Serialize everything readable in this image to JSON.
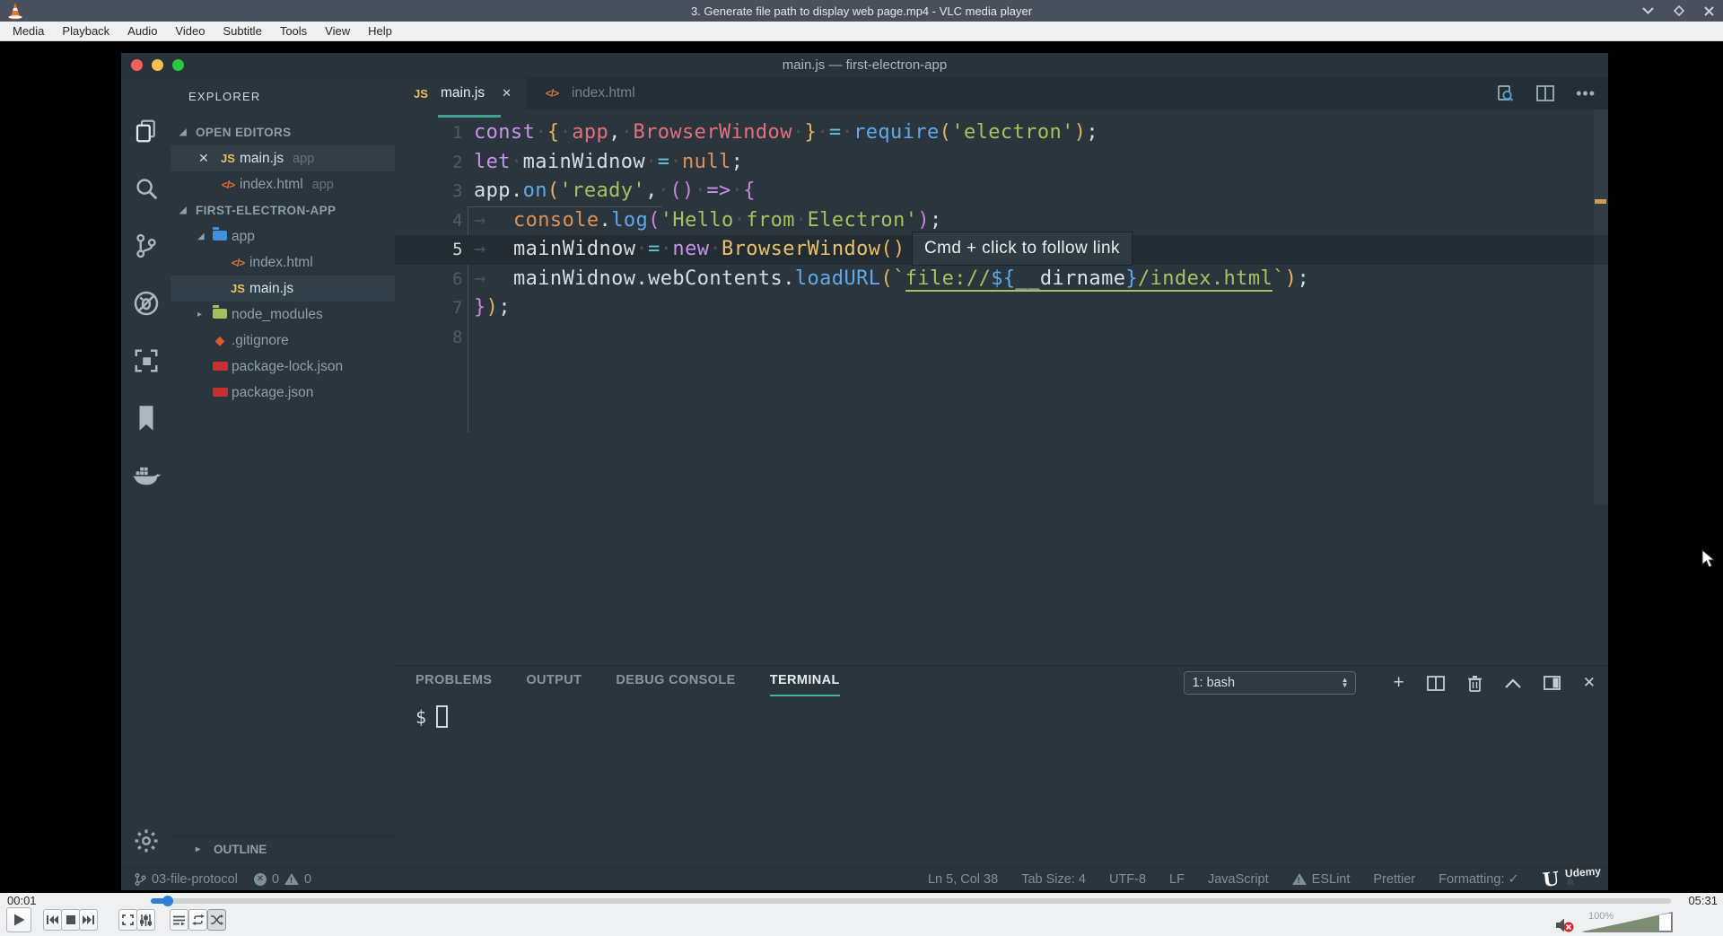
{
  "vlc": {
    "title": "3. Generate file path to display web page.mp4 - VLC media player",
    "menu": [
      "Media",
      "Playback",
      "Audio",
      "Video",
      "Subtitle",
      "Tools",
      "View",
      "Help"
    ],
    "window_controls": {
      "minimize": "chevron-down",
      "maximize": "diamond",
      "close": "✕"
    },
    "time_current": "00:01",
    "time_total": "05:31",
    "volume_label": "100%",
    "position_pct": 1,
    "transport": [
      "play",
      "previous",
      "stop",
      "next",
      "fullscreen",
      "extended-settings",
      "playlist",
      "loop",
      "random"
    ],
    "random_active": true
  },
  "vscode": {
    "window_title": "main.js — first-electron-app",
    "activity_icons": [
      "files",
      "search",
      "source-control",
      "debug",
      "extensions",
      "bookmark",
      "docker",
      "settings-gear"
    ],
    "explorer": {
      "header": "EXPLORER",
      "open_editors_label": "OPEN EDITORS",
      "open_editors": [
        {
          "close": "✕",
          "icon": "js",
          "name": "main.js",
          "badge": "app",
          "hl": true
        },
        {
          "icon": "html",
          "name": "index.html",
          "badge": "app"
        }
      ],
      "project_label": "FIRST-ELECTRON-APP",
      "tree": [
        {
          "arrow": "expanded",
          "icon": "folder-blue",
          "name": "app",
          "depth": 1
        },
        {
          "icon": "html",
          "name": "index.html",
          "depth": 2
        },
        {
          "icon": "js",
          "name": "main.js",
          "depth": 2,
          "hl": true
        },
        {
          "arrow": "collapsed",
          "icon": "folder-green",
          "name": "node_modules",
          "depth": 1
        },
        {
          "icon": "git",
          "name": ".gitignore",
          "depth": 1
        },
        {
          "icon": "npm",
          "name": "package-lock.json",
          "depth": 1
        },
        {
          "icon": "npm",
          "name": "package.json",
          "depth": 1
        }
      ],
      "outline_label": "OUTLINE"
    },
    "tabs": [
      {
        "icon": "js",
        "label": "main.js",
        "close": "✕",
        "active": true
      },
      {
        "icon": "html",
        "label": "index.html"
      }
    ],
    "editor": {
      "tooltip": "Cmd + click to follow link",
      "lines": [
        {
          "n": "1",
          "t": [
            [
              "kw",
              "const"
            ],
            [
              "fg",
              " "
            ],
            [
              "b1",
              "{"
            ],
            [
              "fg",
              " "
            ],
            [
              "red",
              "app"
            ],
            [
              "fg",
              ", "
            ],
            [
              "red",
              "BrowserWindow"
            ],
            [
              "fg",
              " "
            ],
            [
              "b1",
              "}"
            ],
            [
              "fg",
              " "
            ],
            [
              "op",
              "="
            ],
            [
              "fg",
              " "
            ],
            [
              "blue",
              "require"
            ],
            [
              "b1",
              "("
            ],
            [
              "str",
              "'electron'"
            ],
            [
              "b1",
              ")"
            ],
            [
              "fg",
              ";"
            ]
          ]
        },
        {
          "n": "2",
          "t": [
            [
              "kw",
              "let"
            ],
            [
              "fg",
              " "
            ],
            [
              "fg",
              "mainWidnow"
            ],
            [
              "fg",
              " "
            ],
            [
              "op",
              "="
            ],
            [
              "fg",
              " "
            ],
            [
              "orange",
              "null"
            ],
            [
              "fg",
              ";"
            ]
          ]
        },
        {
          "n": "3",
          "t": [
            [
              "fg",
              "app"
            ],
            [
              "fg",
              "."
            ],
            [
              "blue",
              "on"
            ],
            [
              "b1",
              "("
            ],
            [
              "str",
              "'ready'"
            ],
            [
              "fg",
              ", "
            ],
            [
              "b2",
              "()"
            ],
            [
              "fg",
              " "
            ],
            [
              "kw",
              "=>"
            ],
            [
              "fg",
              " "
            ],
            [
              "b2",
              "{"
            ]
          ]
        },
        {
          "n": "4",
          "t": [
            [
              "tab",
              ""
            ],
            [
              "orange",
              "console"
            ],
            [
              "fg",
              "."
            ],
            [
              "blue",
              "log"
            ],
            [
              "b2",
              "("
            ],
            [
              "str",
              "'Hello from Electron'"
            ],
            [
              "b2",
              ")"
            ],
            [
              "fg",
              ";"
            ]
          ]
        },
        {
          "n": "5",
          "cur": true,
          "t": [
            [
              "tab",
              ""
            ],
            [
              "fg",
              "mainWidnow"
            ],
            [
              "fg",
              " "
            ],
            [
              "op",
              "="
            ],
            [
              "fg",
              " "
            ],
            [
              "kw",
              "new"
            ],
            [
              "fg",
              " "
            ],
            [
              "yellow",
              "BrowserWindow"
            ],
            [
              "b1",
              "()"
            ]
          ]
        },
        {
          "n": "6",
          "t": [
            [
              "tab",
              ""
            ],
            [
              "fg",
              "mainWidnow"
            ],
            [
              "fg",
              "."
            ],
            [
              "fg",
              "webContents"
            ],
            [
              "fg",
              "."
            ],
            [
              "blue",
              "loadURL"
            ],
            [
              "b1",
              "("
            ],
            [
              "str",
              "`"
            ],
            [
              "stru",
              "file://"
            ],
            [
              "interp",
              "${"
            ],
            [
              "varu",
              "__dirname"
            ],
            [
              "interp",
              "}"
            ],
            [
              "stru",
              "/index.html"
            ],
            [
              "str",
              "`"
            ],
            [
              "b1",
              ")"
            ],
            [
              "fg",
              ";"
            ]
          ]
        },
        {
          "n": "7",
          "t": [
            [
              "b2",
              "}"
            ],
            [
              "b1",
              ")"
            ],
            [
              "fg",
              ";"
            ]
          ]
        },
        {
          "n": "8",
          "t": []
        }
      ]
    },
    "panel": {
      "tabs": [
        "PROBLEMS",
        "OUTPUT",
        "DEBUG CONSOLE",
        "TERMINAL"
      ],
      "active_tab": "TERMINAL",
      "shell_select": "1: bash",
      "toolbar_icons": [
        "new-terminal",
        "split-terminal",
        "kill-terminal",
        "maximize-panel",
        "toggle-panel-position",
        "close-panel"
      ],
      "prompt": "$"
    },
    "statusbar": {
      "branch": "03-file-protocol",
      "errors": "0",
      "warnings": "0",
      "right_items": [
        {
          "label": "Ln 5, Col 38"
        },
        {
          "label": "Tab Size: 4"
        },
        {
          "label": "UTF-8"
        },
        {
          "label": "LF"
        },
        {
          "label": "JavaScript"
        },
        {
          "label": "ESLint",
          "warn_icon": true
        },
        {
          "label": "Prettier"
        },
        {
          "label": "Formatting: ✓"
        }
      ],
      "watermark": {
        "logo": "U",
        "name": "Udemy"
      }
    }
  }
}
